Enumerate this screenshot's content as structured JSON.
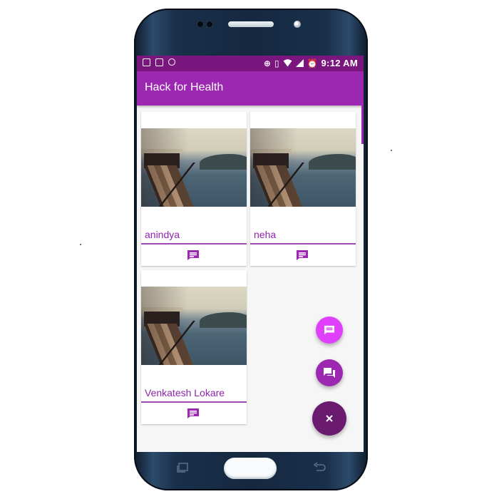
{
  "status_bar": {
    "time": "9:12 AM",
    "left_icons": [
      "gallery-icon",
      "image-icon",
      "notification-icon"
    ],
    "right_icons": [
      "data-saver-icon",
      "vibrate-icon",
      "wifi-icon",
      "signal-icon",
      "alarm-icon"
    ]
  },
  "app_bar": {
    "title": "Hack for Health"
  },
  "cards": [
    {
      "name": "anindya",
      "action_icon": "message-icon"
    },
    {
      "name": "neha",
      "action_icon": "message-icon"
    },
    {
      "name": "Venkatesh Lokare",
      "action_icon": "message-icon"
    }
  ],
  "fabs": [
    {
      "icon": "message-icon",
      "color": "#e040fb"
    },
    {
      "icon": "forum-icon",
      "color": "#9c27b0"
    },
    {
      "icon": "close-icon",
      "color": "#6a1b6f"
    }
  ],
  "colors": {
    "status_bar": "#7a177f",
    "app_bar": "#9c27b0",
    "accent_text": "#8e24aa"
  }
}
